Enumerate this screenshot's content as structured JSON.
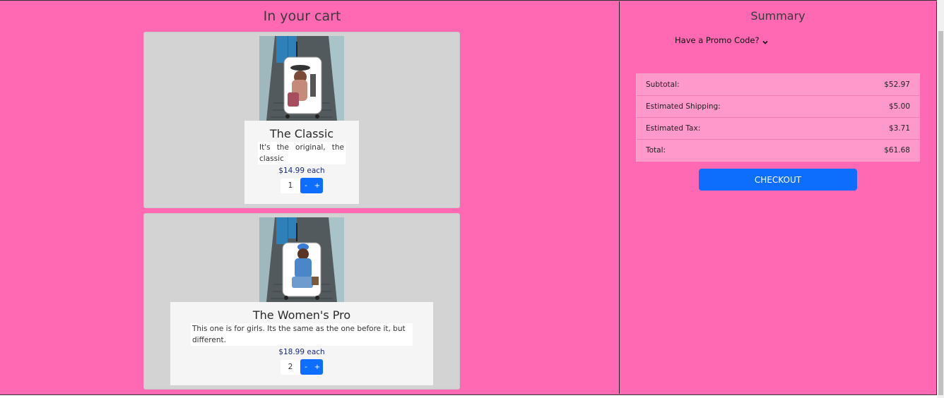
{
  "cart": {
    "title": "In your cart",
    "items": [
      {
        "name": "The Classic",
        "description": "It's the original, the classic",
        "price": "$14.99 each",
        "quantity": "1",
        "minus_label": "-",
        "plus_label": "+"
      },
      {
        "name": "The Women's Pro",
        "description": "This one is for girls. Its the same as the one before it, but different.",
        "price": "$18.99 each",
        "quantity": "2",
        "minus_label": "-",
        "plus_label": "+"
      }
    ]
  },
  "summary": {
    "title": "Summary",
    "promo_label": "Have a Promo Code?",
    "rows": [
      {
        "label": "Subtotal:",
        "value": "$52.97"
      },
      {
        "label": "Estimated Shipping:",
        "value": "$5.00"
      },
      {
        "label": "Estimated Tax:",
        "value": "$3.71"
      },
      {
        "label": "Total:",
        "value": "$61.68"
      }
    ],
    "checkout_label": "CHECKOUT"
  },
  "colors": {
    "page_background": "#ff69b4",
    "card_background": "#d3d3d3",
    "summary_table_background": "#ff99cc",
    "button_primary": "#0d6efd"
  }
}
